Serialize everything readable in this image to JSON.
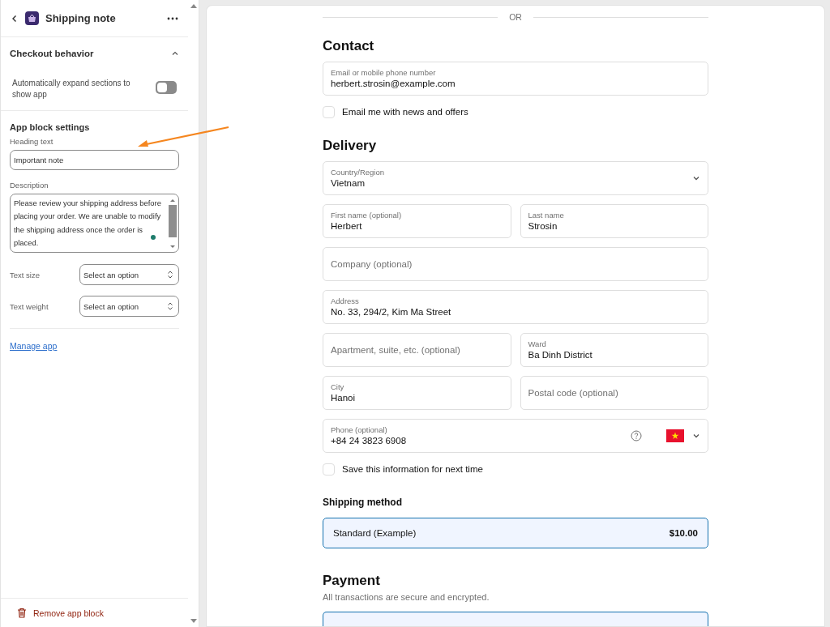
{
  "sidebar": {
    "title": "Shipping note",
    "section": {
      "title": "Checkout behavior",
      "expanded": true
    },
    "toggle": {
      "label": "Automatically expand sections to show app",
      "on": false
    },
    "settings_title": "App block settings",
    "heading_field": {
      "label": "Heading text",
      "value": "Important note"
    },
    "description_field": {
      "label": "Description",
      "value": "Please review your shipping address before placing your order. We are unable to modify the shipping address once the order is placed."
    },
    "selects": [
      {
        "label": "Text size",
        "placeholder": "Select an option"
      },
      {
        "label": "Text weight",
        "placeholder": "Select an option"
      }
    ],
    "link": "Manage app",
    "remove_button": "Remove app block"
  },
  "checkout": {
    "divider": "OR",
    "contact": {
      "title": "Contact",
      "field": {
        "kind": "text",
        "label": "Email or mobile phone number",
        "value": "herbert.strosin@example.com"
      },
      "checkbox": {
        "label": "Email me with news and offers",
        "checked": false
      }
    },
    "delivery": {
      "title": "Delivery",
      "rows": [
        [
          {
            "kind": "select",
            "label": "Country/Region",
            "value": "Vietnam"
          }
        ],
        [
          {
            "kind": "text",
            "label": "First name (optional)",
            "value": "Herbert"
          },
          {
            "kind": "text",
            "label": "Last name",
            "value": "Strosin"
          }
        ],
        [
          {
            "kind": "text",
            "placeholder": "Company (optional)"
          }
        ],
        [
          {
            "kind": "text",
            "label": "Address",
            "value": "No. 33, 294/2, Kim Ma Street"
          }
        ],
        [
          {
            "kind": "text",
            "placeholder": "Apartment, suite, etc. (optional)"
          },
          {
            "kind": "text",
            "label": "Ward",
            "value": "Ba Dinh District"
          }
        ],
        [
          {
            "kind": "text",
            "label": "City",
            "value": "Hanoi"
          },
          {
            "kind": "text",
            "placeholder": "Postal code (optional)"
          }
        ],
        [
          {
            "kind": "phone",
            "label": "Phone (optional)",
            "value": "+84 24 3823 6908"
          }
        ]
      ],
      "checkbox": {
        "label": "Save this information for next time",
        "checked": false
      }
    },
    "shipping": {
      "title": "Shipping method",
      "options": [
        {
          "name": "Standard (Example)",
          "price": "$10.00",
          "selected": true
        }
      ]
    },
    "payment": {
      "title": "Payment",
      "subtitle": "All transactions are secure and encrypted."
    }
  }
}
